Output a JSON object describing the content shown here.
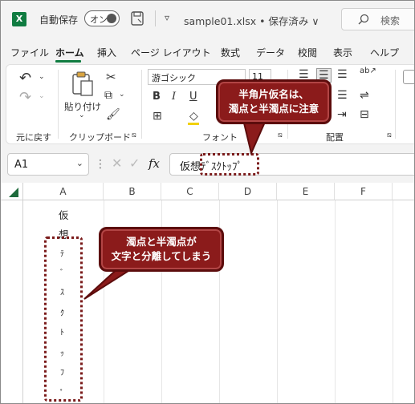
{
  "titlebar": {
    "app_icon": "excel-logo",
    "autosave_label": "自動保存",
    "toggle_label": "オン",
    "filename": "sample01.xlsx • 保存済み ∨",
    "search_placeholder": "検索"
  },
  "tabs": [
    "ファイル",
    "ホーム",
    "挿入",
    "ページ レイアウト",
    "数式",
    "データ",
    "校閲",
    "表示",
    "ヘルプ"
  ],
  "active_tab": "ホーム",
  "ribbon": {
    "undo_label": "元に戻す",
    "clipboard_label": "クリップボード",
    "paste_label": "貼り付け",
    "font_label": "フォント",
    "align_label": "配置",
    "font_name": "游ゴシック",
    "font_size": "11",
    "bold": "B",
    "italic": "I",
    "underline": "U"
  },
  "formula_bar": {
    "name_box": "A1",
    "fx": "fx",
    "formula": "仮想ﾃﾞｽｸﾄｯﾌﾟ"
  },
  "grid": {
    "columns": [
      "A",
      "B",
      "C",
      "D",
      "E",
      "F"
    ],
    "cells_a": [
      "仮",
      "想",
      "ﾃ",
      "ﾞ",
      "ｽ",
      "ｸ",
      "ﾄ",
      "ｯ",
      "ﾌ",
      "ﾟ"
    ]
  },
  "callouts": {
    "top_line1": "半角片仮名は、",
    "top_line2": "濁点と半濁点に注意",
    "mid_line1": "濁点と半濁点が",
    "mid_line2": "文字と分離してしまう"
  },
  "colors": {
    "excel_green": "#107c41",
    "callout_red": "#8b1b1b"
  }
}
